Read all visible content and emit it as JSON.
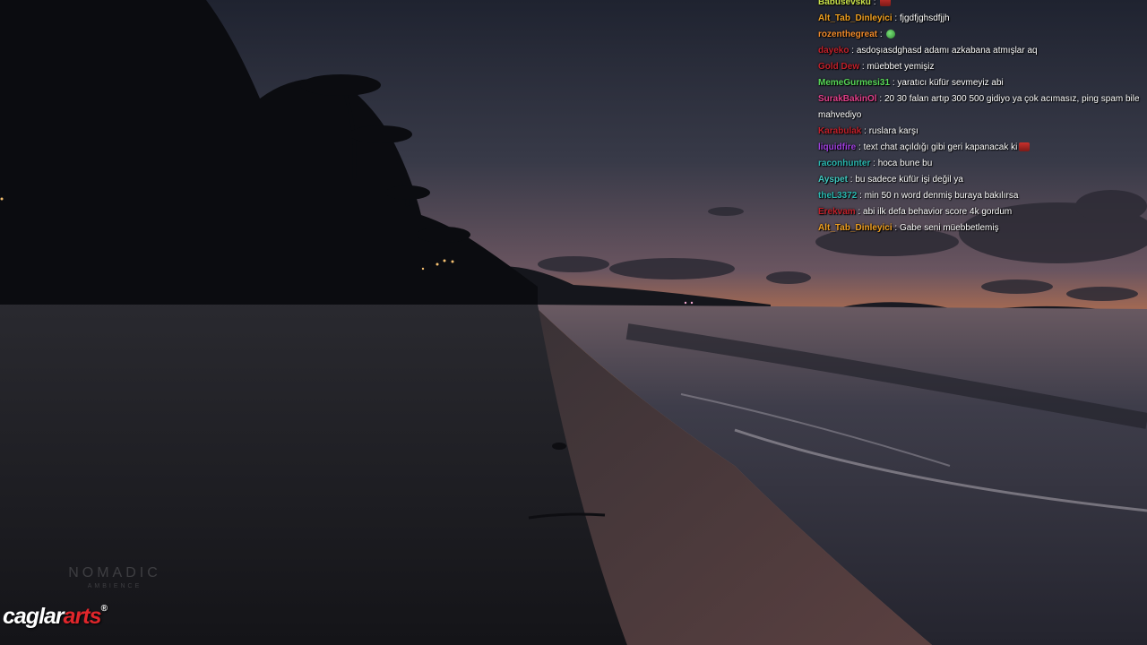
{
  "chat": {
    "messages": [
      {
        "user": "Babusevsku",
        "color": "#c8e04a",
        "text": "",
        "emote": "red-emote"
      },
      {
        "user": "Alt_Tab_Dinleyici",
        "color": "#f0a020",
        "text": "fjgdfjghsdfjjh"
      },
      {
        "user": "rozenthegreat",
        "color": "#f08a2a",
        "text": "",
        "emote": "green-emote"
      },
      {
        "user": "dayeko",
        "color": "#c0202a",
        "text": "asdoşıasdghasd adamı azkabana atmışlar aq"
      },
      {
        "user": "Gold Dew",
        "color": "#c0202a",
        "text": "müebbet yemişiz"
      },
      {
        "user": "MemeGurmesi31",
        "color": "#58d858",
        "text": "yaratıcı küfür sevmeyiz abi"
      },
      {
        "user": "SurakBakinOl",
        "color": "#e0408a",
        "text": "20 30 falan artıp 300 500 gidiyo ya çok acımasız, ping spam bile mahvediyo"
      },
      {
        "user": "Karabulak",
        "color": "#c0202a",
        "text": "ruslara karşı"
      },
      {
        "user": "liquidfire",
        "color": "#a040e0",
        "text": "text chat açıldığı gibi geri kapanacak ki",
        "emote": "red-emote"
      },
      {
        "user": "raconhunter",
        "color": "#2ab8b0",
        "text": "hoca bune bu"
      },
      {
        "user": "Ayspet",
        "color": "#40c8c0",
        "text": "bu sadece küfür işi değil ya"
      },
      {
        "user": "theL3372",
        "color": "#2ab8b0",
        "text": "min 50 n word denmiş buraya bakılırsa"
      },
      {
        "user": "Erekvam",
        "color": "#c0202a",
        "text": "abi ilk defa behavior score 4k gordum"
      },
      {
        "user": "Alt_Tab_Dinleyici",
        "color": "#f0a020",
        "text": "Gabe seni müebbetlemiş"
      }
    ]
  },
  "watermark": {
    "line1": "NOMADIC",
    "line2": "AMBIENCE"
  },
  "brand": {
    "part1": "caglar",
    "part2": "arts",
    "mark": "®"
  },
  "colors": {
    "sky_top": "#2a2f3d",
    "sunset": "#e8892e",
    "sea": "#3a3d4a",
    "sand": "#1e1d22"
  }
}
